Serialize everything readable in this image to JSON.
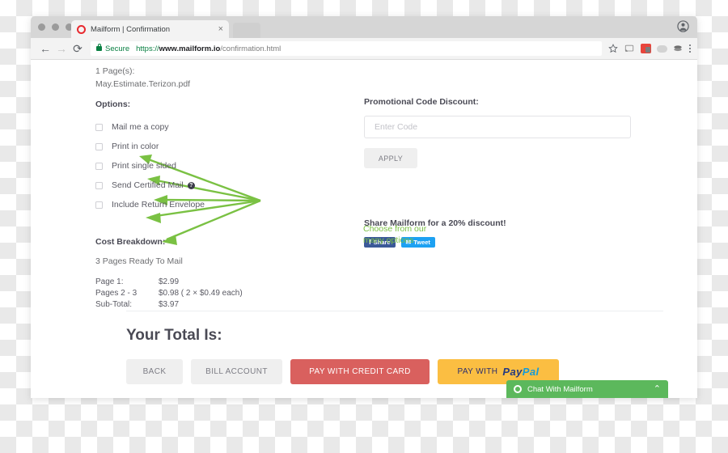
{
  "browser": {
    "tab": {
      "title": "Mailform | Confirmation",
      "favicon": "mailform-logo-icon",
      "close": "×"
    },
    "nav": {
      "back": "←",
      "forward": "→",
      "reload": "⟳"
    },
    "omnibox": {
      "secure_label": "Secure",
      "scheme": "https://",
      "host": "www.mailform.io",
      "path": "/confirmation.html"
    },
    "toolbar_icons": [
      "star-icon",
      "cast-icon",
      "extension-badge-icon",
      "cloud-icon",
      "layers-icon",
      "menu-dots-icon"
    ],
    "avatar": "profile-avatar-icon"
  },
  "page": {
    "pages_count": "1 Page(s):",
    "file_name": "May.Estimate.Terizon.pdf",
    "options_heading": "Options:",
    "options": [
      {
        "label": "Mail me a copy",
        "checked": false,
        "help": false
      },
      {
        "label": "Print in color",
        "checked": false,
        "help": false
      },
      {
        "label": "Print single sided",
        "checked": false,
        "help": false
      },
      {
        "label": "Send Certified Mail",
        "checked": false,
        "help": true,
        "help_glyph": "?"
      },
      {
        "label": "Include Return Envelope",
        "checked": false,
        "help": false
      }
    ],
    "annotation": {
      "line1": "Choose from our",
      "line2": "many options",
      "color": "#7ac143"
    },
    "cost": {
      "heading": "Cost Breakdown:",
      "ready": "3 Pages Ready To Mail",
      "rows": [
        {
          "key": "Page 1:",
          "value": "$2.99"
        },
        {
          "key": "Pages 2 - 3",
          "value": "$0.98 ( 2 × $0.49 each)"
        },
        {
          "key": "Sub-Total:",
          "value": "$3.97"
        }
      ]
    },
    "promo": {
      "heading": "Promotional Code Discount:",
      "placeholder": "Enter Code",
      "value": "",
      "apply_label": "APPLY"
    },
    "share": {
      "heading": "Share Mailform for a 20% discount!",
      "facebook_label": "Share",
      "facebook_glyph": "f",
      "twitter_label": "Tweet",
      "twitter_glyph": "✉",
      "facebook_color": "#3b5998",
      "twitter_color": "#1da1f2"
    },
    "total_heading": "Your Total Is:",
    "buttons": [
      {
        "label": "BACK",
        "style": "grey"
      },
      {
        "label": "BILL ACCOUNT",
        "style": "grey"
      },
      {
        "label": "PAY WITH CREDIT CARD",
        "style": "red"
      },
      {
        "label": "PAY WITH",
        "style": "amber",
        "brand_1": "Pay",
        "brand_2": "Pal"
      }
    ],
    "chat": {
      "label": "Chat With Mailform",
      "chevron": "⌃",
      "color": "#5cb85c"
    }
  }
}
